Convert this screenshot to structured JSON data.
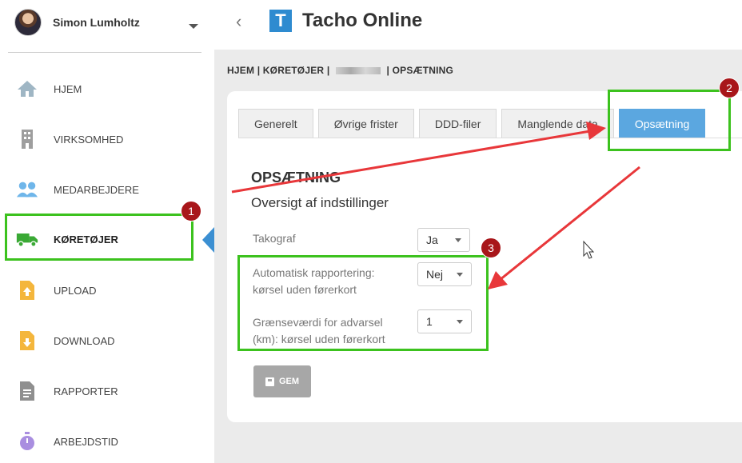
{
  "user": {
    "name": "Simon Lumholtz"
  },
  "header": {
    "back_label": "‹",
    "logo_letter": "T",
    "title": "Tacho Online"
  },
  "sidebar": {
    "items": [
      {
        "label": "HJEM",
        "icon": "home-icon"
      },
      {
        "label": "VIRKSOMHED",
        "icon": "building-icon"
      },
      {
        "label": "MEDARBEJDERE",
        "icon": "users-icon"
      },
      {
        "label": "KØRETØJER",
        "icon": "truck-icon",
        "active": true
      },
      {
        "label": "UPLOAD",
        "icon": "file-upload-icon"
      },
      {
        "label": "DOWNLOAD",
        "icon": "file-download-icon"
      },
      {
        "label": "RAPPORTER",
        "icon": "report-icon"
      },
      {
        "label": "ARBEJDSTID",
        "icon": "stopwatch-icon"
      }
    ]
  },
  "breadcrumb": {
    "home": "HJEM",
    "sep": "|",
    "vehicles": "KØRETØJER",
    "current": "OPSÆTNING"
  },
  "tabs": [
    {
      "label": "Generelt"
    },
    {
      "label": "Øvrige frister"
    },
    {
      "label": "DDD-filer"
    },
    {
      "label": "Manglende data"
    },
    {
      "label": "Opsætning",
      "active": true
    }
  ],
  "section": {
    "title": "OPSÆTNING",
    "subtitle": "Oversigt af indstillinger"
  },
  "fields": {
    "tachograph": {
      "label": "Takograf",
      "value": "Ja"
    },
    "auto_report": {
      "label_line1": "Automatisk rapportering:",
      "label_line2": "kørsel uden førerkort",
      "value": "Nej"
    },
    "threshold": {
      "label_line1": "Grænseværdi for advarsel",
      "label_line2": "(km): kørsel uden førerkort",
      "value": "1"
    }
  },
  "save_button": {
    "label": "GEM"
  },
  "annotations": {
    "badge1": "1",
    "badge2": "2",
    "badge3": "3"
  },
  "colors": {
    "accent": "#5ba7e0",
    "highlight": "#3cc21e",
    "badge": "#a8161a",
    "arrow": "#e8373a"
  }
}
